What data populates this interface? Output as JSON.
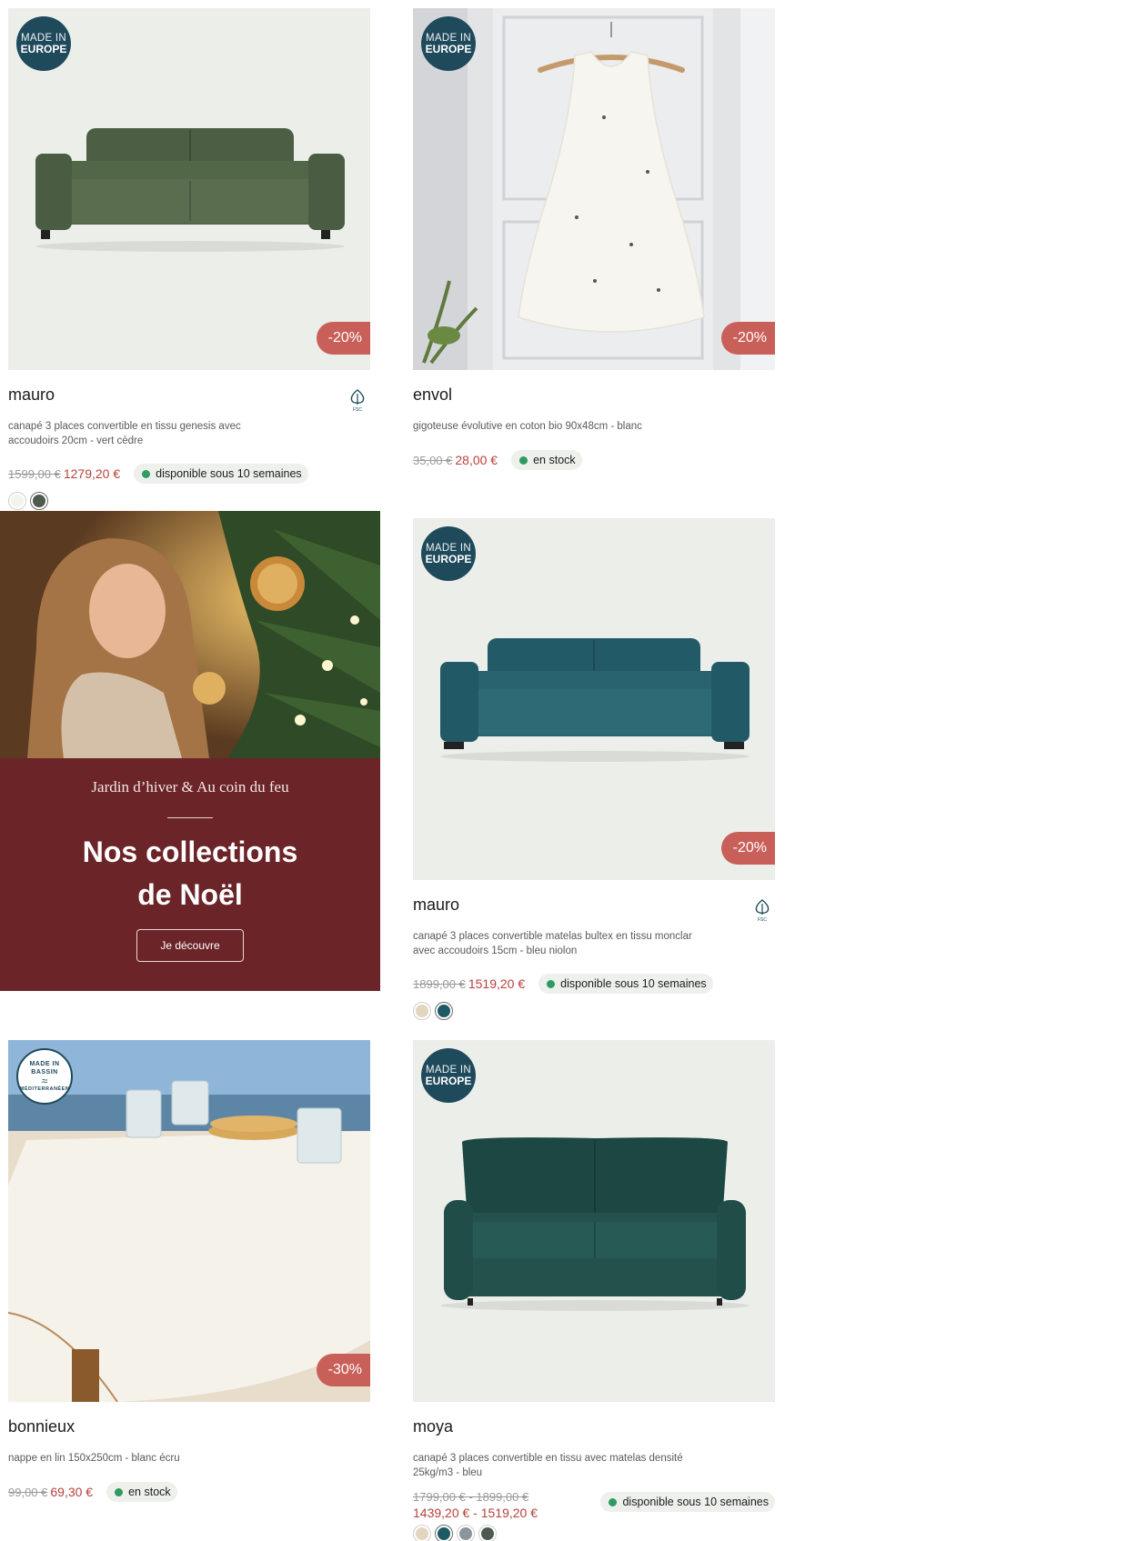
{
  "badges": {
    "made_in_l1": "MADE IN",
    "made_in_l2": "EUROPE",
    "med_l1": "MADE IN",
    "med_l2": "BASSIN",
    "med_l3": "MÉDITERRANÉEN"
  },
  "products": [
    {
      "name": "mauro",
      "description": "canapé 3 places convertible en tissu genesis avec accoudoirs 20cm - vert cèdre",
      "old_price": "1599,00 €",
      "new_price": "1279,20 €",
      "availability": "disponible sous 10 semaines",
      "discount": "-20%",
      "badge": "made-in-europe",
      "fsc": true,
      "swatches": [
        "#f4f4ef",
        "#4f5a4f"
      ],
      "selected_swatch": 1,
      "image_subject": "green-sofa"
    },
    {
      "name": "envol",
      "description": "gigoteuse évolutive en coton bio 90x48cm - blanc",
      "old_price": "35,00 €",
      "new_price": "28,00 €",
      "availability": "en stock",
      "discount": "-20%",
      "badge": "made-in-europe",
      "fsc": false,
      "image_subject": "sleeping-bag-on-hanger"
    },
    {
      "name": "mauro",
      "description": "canapé 3 places convertible matelas bultex en tissu monclar avec accoudoirs 15cm - bleu niolon",
      "old_price": "1899,00 €",
      "new_price": "1519,20 €",
      "availability": "disponible sous 10 semaines",
      "discount": "-20%",
      "badge": "made-in-europe",
      "fsc": true,
      "swatches": [
        "#e3d6bf",
        "#1e5a66"
      ],
      "selected_swatch": 1,
      "image_subject": "teal-sofa"
    },
    {
      "name": "bonnieux",
      "description": "nappe en lin 150x250cm - blanc écru",
      "old_price": "99,00 €",
      "new_price": "69,30 €",
      "availability": "en stock",
      "discount": "-30%",
      "badge": "made-in-bassin-mediterraneen",
      "fsc": false,
      "image_subject": "white-tablecloth-terrace"
    },
    {
      "name": "moya",
      "description": "canapé 3 places convertible en tissu avec matelas densité 25kg/m3 - bleu",
      "old_price": "1799,00 € - 1899,00 €",
      "new_price": "1439,20 € - 1519,20 €",
      "availability": "disponible sous 10 semaines",
      "badge": "made-in-europe",
      "fsc": false,
      "swatches": [
        "#e3d6bf",
        "#1e5a66",
        "#8a969a",
        "#4f5a4f"
      ],
      "selected_swatch": 1,
      "image_subject": "dark-green-sofa"
    }
  ],
  "promo": {
    "subtitle": "Jardin d’hiver & Au coin du feu",
    "title_line1": "Nos collections",
    "title_line2": "de Noël",
    "button_label": "Je découvre",
    "background": "#6b2428"
  },
  "colors": {
    "discount": "#c95f59",
    "price_new": "#b7413b",
    "stock_dot": "#2f9a63",
    "badge": "#1f4a5c"
  }
}
